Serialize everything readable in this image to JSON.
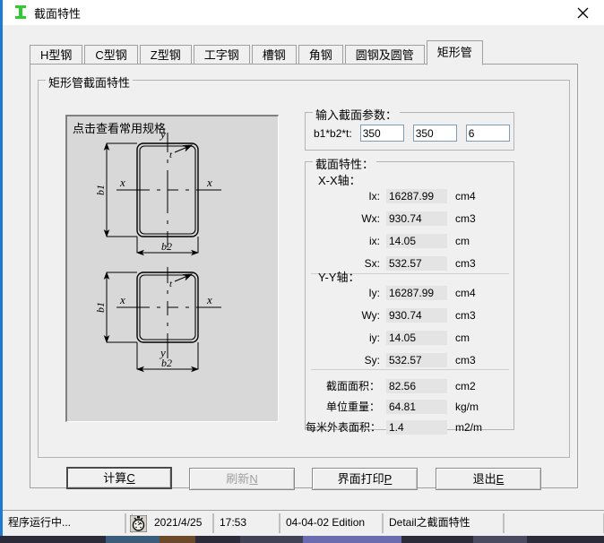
{
  "window": {
    "title": "截面特性",
    "icon": "i-beam-icon",
    "close_label": "✕"
  },
  "tabs": [
    {
      "label": "H型钢",
      "active": false
    },
    {
      "label": "C型钢",
      "active": false
    },
    {
      "label": "Z型钢",
      "active": false
    },
    {
      "label": "工字钢",
      "active": false
    },
    {
      "label": "槽钢",
      "active": false
    },
    {
      "label": "角钢",
      "active": false
    },
    {
      "label": "圆钢及圆管",
      "active": false
    },
    {
      "label": "矩形管",
      "active": true
    }
  ],
  "outer_group": {
    "label": "矩形管截面特性"
  },
  "diagram": {
    "hint": "点击查看常用规格",
    "labels": {
      "y": "y",
      "x": "x",
      "t": "t",
      "b1": "b1",
      "b2": "b2"
    }
  },
  "params_group": {
    "label": "输入截面参数：",
    "row_label": "b1*b2*t:",
    "fields": [
      {
        "name": "b1",
        "value": "350"
      },
      {
        "name": "b2",
        "value": "350"
      },
      {
        "name": "t",
        "value": "6"
      }
    ]
  },
  "props_group": {
    "label": "截面特性：",
    "axis_x_label": "X-X轴：",
    "axis_y_label": "Y-Y轴：",
    "x_axis": [
      {
        "name": "Ix:",
        "value": "16287.99",
        "unit": "cm4"
      },
      {
        "name": "Wx:",
        "value": "930.74",
        "unit": "cm3"
      },
      {
        "name": "ix:",
        "value": "14.05",
        "unit": "cm"
      },
      {
        "name": "Sx:",
        "value": "532.57",
        "unit": "cm3"
      }
    ],
    "y_axis": [
      {
        "name": "Iy:",
        "value": "16287.99",
        "unit": "cm4"
      },
      {
        "name": "Wy:",
        "value": "930.74",
        "unit": "cm3"
      },
      {
        "name": "iy:",
        "value": "14.05",
        "unit": "cm"
      },
      {
        "name": "Sy:",
        "value": "532.57",
        "unit": "cm3"
      }
    ],
    "summary": [
      {
        "name": "截面面积：",
        "value": "82.56",
        "unit": "cm2"
      },
      {
        "name": "单位重量：",
        "value": "64.81",
        "unit": "kg/m"
      },
      {
        "name": "每米外表面积：",
        "value": "1.4",
        "unit": "m2/m"
      }
    ]
  },
  "buttons": [
    {
      "label": "计算",
      "accel": "C",
      "state": "default"
    },
    {
      "label": "刷新",
      "accel": "N",
      "state": "disabled"
    },
    {
      "label": "界面打印",
      "accel": "P",
      "state": "normal"
    },
    {
      "label": "退出",
      "accel": "E",
      "state": "normal"
    }
  ],
  "statusbar": {
    "message": "程序运行中...",
    "icon": "stopwatch-icon",
    "date": "2021/4/25",
    "time": "17:53",
    "edition": "04-04-02 Edition",
    "module": "Detail之截面特性",
    "extra": ""
  },
  "colors": {
    "accent": "#1f7ad4",
    "window_bg": "#f0f0f0",
    "panel_bg": "#d8d8d8",
    "field_bg": "#e4e4e4",
    "icon_green": "#2ecc2e"
  }
}
